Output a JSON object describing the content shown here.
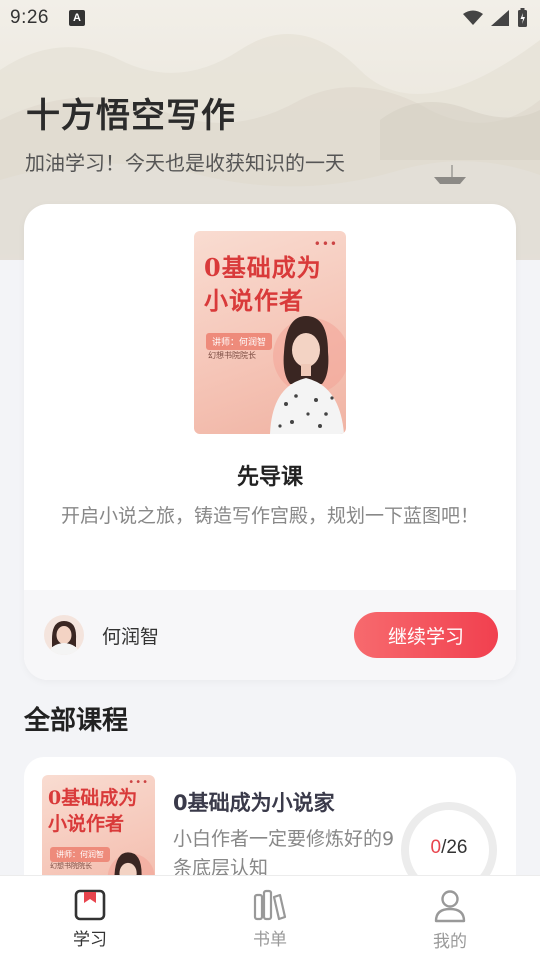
{
  "status_bar": {
    "time": "9:26",
    "notification_letter": "A"
  },
  "header": {
    "title": "十方悟空写作",
    "subtitle": "加油学习！今天也是收获知识的一天"
  },
  "featured": {
    "cover": {
      "title_line1": "0基础成为",
      "title_line2": "小说作者",
      "tag": "讲师：何润智",
      "sub": "幻想书院院长",
      "dots": "•••"
    },
    "course_name": "先导课",
    "description": "开启小说之旅，铸造写作宫殿，规划一下蓝图吧！",
    "teacher_name": "何润智",
    "continue_label": "继续学习"
  },
  "all_courses": {
    "section_title": "全部课程",
    "items": [
      {
        "cover": {
          "title_line1": "0基础成为",
          "title_line2": "小说作者",
          "tag": "讲师：何润智",
          "sub": "幻想书院院长",
          "dots": "•••"
        },
        "name": "0基础成为小说家",
        "description": "小白作者一定要修炼好的9条底层认知",
        "progress_done": "0",
        "progress_total": "/26",
        "progress_fraction": 0
      }
    ]
  },
  "bottom_nav": {
    "items": [
      {
        "label": "学习",
        "icon": "study-icon",
        "active": true
      },
      {
        "label": "书单",
        "icon": "booklist-icon",
        "active": false
      },
      {
        "label": "我的",
        "icon": "profile-icon",
        "active": false
      }
    ]
  },
  "colors": {
    "accent": "#f1404f",
    "progress_done": "#e8454e",
    "cover_title": "#d93a3a",
    "cover_bg": "#f5c4b6"
  }
}
